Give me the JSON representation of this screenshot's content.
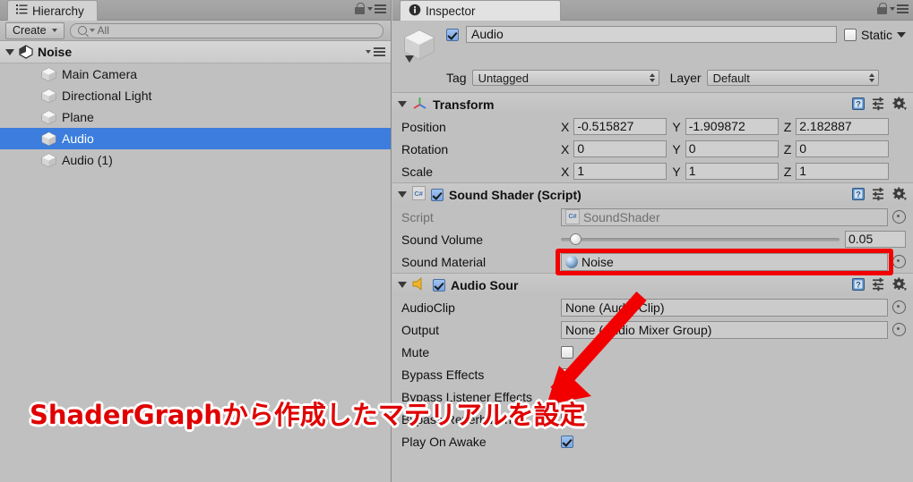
{
  "hierarchy": {
    "tab_label": "Hierarchy",
    "tab_icon": "hierarchy-list-icon",
    "create_label": "Create",
    "search_placeholder": "All",
    "scene_name": "Noise",
    "items": [
      {
        "label": "Main Camera",
        "selected": false
      },
      {
        "label": "Directional Light",
        "selected": false
      },
      {
        "label": "Plane",
        "selected": false
      },
      {
        "label": "Audio",
        "selected": true
      },
      {
        "label": "Audio (1)",
        "selected": false
      }
    ]
  },
  "inspector": {
    "tab_label": "Inspector",
    "tab_icon": "info-icon",
    "object": {
      "enabled": true,
      "name": "Audio",
      "static_label": "Static",
      "static_checked": false,
      "tag_label": "Tag",
      "tag_value": "Untagged",
      "layer_label": "Layer",
      "layer_value": "Default"
    },
    "components": [
      {
        "title": "Transform",
        "icon": "transform-axis-icon",
        "has_enable_checkbox": false,
        "rows": [
          {
            "label": "Position",
            "type": "vector3",
            "x": "-0.515827",
            "y": "-1.909872",
            "z": "2.182887"
          },
          {
            "label": "Rotation",
            "type": "vector3",
            "x": "0",
            "y": "0",
            "z": "0"
          },
          {
            "label": "Scale",
            "type": "vector3",
            "x": "1",
            "y": "1",
            "z": "1"
          }
        ]
      },
      {
        "title": "Sound Shader (Script)",
        "icon": "csharp-script-icon",
        "has_enable_checkbox": true,
        "enabled": true,
        "rows": [
          {
            "label": "Script",
            "type": "object",
            "value": "SoundShader",
            "icon": "csharp-script-icon",
            "dim": true
          },
          {
            "label": "Sound Volume",
            "type": "slider",
            "value": "0.05",
            "percent": 5
          },
          {
            "label": "Sound Material",
            "type": "object",
            "value": "Noise",
            "icon": "material-sphere-icon",
            "highlighted": true
          }
        ]
      },
      {
        "title": "Audio Sour",
        "icon": "speaker-icon",
        "has_enable_checkbox": true,
        "enabled": true,
        "rows": [
          {
            "label": "AudioClip",
            "type": "object",
            "value": "None (Audio Clip)"
          },
          {
            "label": "Output",
            "type": "object",
            "value": "None (Audio Mixer Group)"
          },
          {
            "label": "Mute",
            "type": "checkbox",
            "checked": false
          },
          {
            "label": "Bypass Effects",
            "type": "checkbox",
            "checked": false
          },
          {
            "label": "Bypass Listener Effects",
            "type": "checkbox",
            "checked": false
          },
          {
            "label": "Bypass Reverb Zones",
            "type": "checkbox",
            "checked": false
          },
          {
            "label": "Play On Awake",
            "type": "checkbox",
            "checked": true
          }
        ]
      }
    ]
  },
  "annotation": {
    "text": "ShaderGraphから作成したマテリアルを設定",
    "color": "#e00000",
    "arrow_color": "#f20000",
    "highlight_color": "#f20000"
  },
  "axis_labels": {
    "x": "X",
    "y": "Y",
    "z": "Z"
  }
}
